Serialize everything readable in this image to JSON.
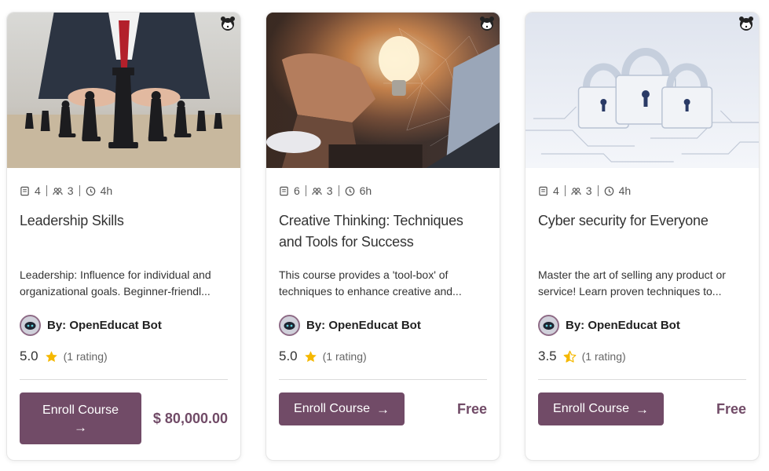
{
  "colors": {
    "primary": "#714b67",
    "star": "#f5b800",
    "border": "#e6e6e6"
  },
  "icons": {
    "lessons": "book-icon",
    "members": "users-icon",
    "duration": "clock-icon",
    "rating": "star-icon",
    "badge": "raccoon-badge-icon",
    "enroll": "arrow-right-icon"
  },
  "courses": [
    {
      "image": "chess-pieces-businessman",
      "lessons": "4",
      "members": "3",
      "duration": "4h",
      "title": "Leadership Skills",
      "description": "Leadership: Influence for individual and organizational goals. Beginner-friendl...",
      "author": "By: OpenEducat Bot",
      "rating_value": "5.0",
      "rating_stars": 5,
      "rating_count": "(1 rating)",
      "enroll_label": "Enroll Course",
      "price": "$ 80,000.00"
    },
    {
      "image": "lightbulb-hand-laptop",
      "lessons": "6",
      "members": "3",
      "duration": "6h",
      "title": "Creative Thinking: Techniques and Tools for Success",
      "description": "This course provides a 'tool-box' of techniques to enhance creative and...",
      "author": "By: OpenEducat Bot",
      "rating_value": "5.0",
      "rating_stars": 5,
      "rating_count": "(1 rating)",
      "enroll_label": "Enroll Course",
      "price": "Free"
    },
    {
      "image": "padlocks-circuit-board",
      "lessons": "4",
      "members": "3",
      "duration": "4h",
      "title": "Cyber security for Everyone",
      "description": "Master the art of selling any product or service! Learn proven techniques to...",
      "author": "By: OpenEducat Bot",
      "rating_value": "3.5",
      "rating_stars": 3.5,
      "rating_count": "(1 rating)",
      "enroll_label": "Enroll Course",
      "price": "Free"
    }
  ]
}
